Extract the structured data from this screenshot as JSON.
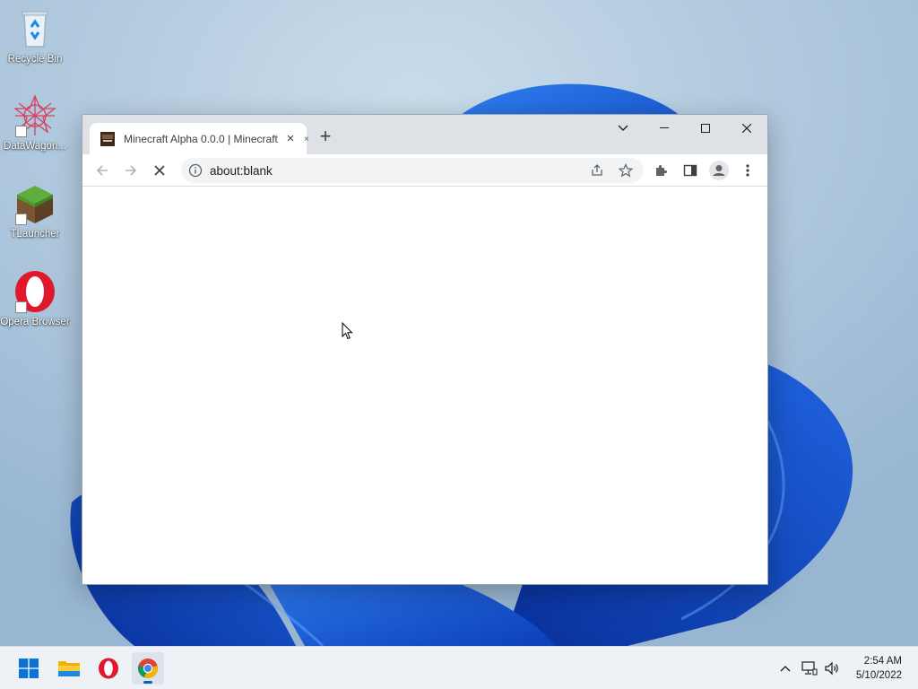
{
  "desktop": {
    "icons": [
      {
        "label": "Recycle Bin",
        "icon": "recycle-bin-icon"
      },
      {
        "label": "DataWagon...",
        "icon": "datawagon-icon"
      },
      {
        "label": "TLauncher",
        "icon": "grass-block-icon"
      },
      {
        "label": "Opera Browser",
        "icon": "opera-icon"
      }
    ]
  },
  "browser": {
    "tab": {
      "title": "Minecraft Alpha 0.0.0 | Minecraft",
      "close": "×",
      "favicon": "minecraft-favicon"
    },
    "tab_overflow_close": "×",
    "new_tab": "+",
    "window_controls": {
      "menu": "tab-search-chevron",
      "minimize": "minimize-icon",
      "maximize": "maximize-icon",
      "close": "close-icon"
    },
    "address": "about:blank",
    "nav": {
      "back": "back-arrow-icon",
      "forward": "forward-arrow-icon",
      "stop": "stop-icon"
    },
    "toolbar_icons": [
      "share-icon",
      "bookmark-star-icon",
      "extensions-puzzle-icon",
      "side-panel-icon",
      "profile-avatar-icon",
      "menu-kebab-icon"
    ]
  },
  "taskbar": {
    "apps": [
      "windows-start-icon",
      "file-explorer-icon",
      "opera-icon",
      "chrome-icon"
    ],
    "active_app": "chrome-icon",
    "tray": [
      "chevron-up-icon",
      "network-icon",
      "volume-icon"
    ],
    "time": "2:54 AM",
    "date": "5/10/2022"
  },
  "colors": {
    "accent": "#0067c0",
    "tabstrip": "#dee1e6",
    "omnibox": "#f1f3f4"
  }
}
